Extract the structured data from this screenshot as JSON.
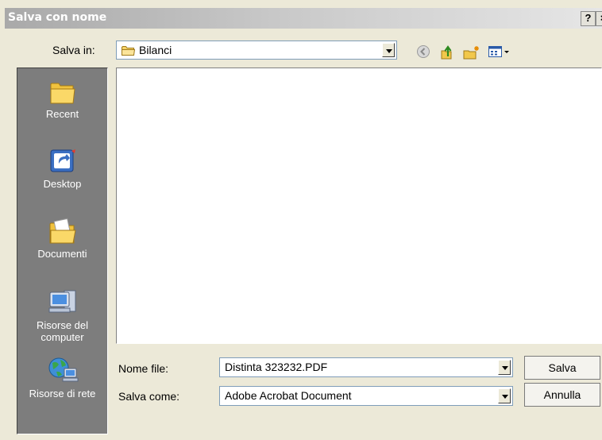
{
  "window": {
    "title": "Salva con nome",
    "help_label": "?",
    "close_label": "×"
  },
  "toolbar": {
    "save_in_label": "Salva in:",
    "current_folder": "Bilanci",
    "tools": [
      "back-icon",
      "up-folder-icon",
      "new-folder-icon",
      "view-menu-icon"
    ]
  },
  "places": [
    {
      "label": "Recent",
      "icon": "recent-folder-icon"
    },
    {
      "label": "Desktop",
      "icon": "desktop-icon"
    },
    {
      "label": "Documenti",
      "icon": "documents-folder-icon"
    },
    {
      "label_line1": "Risorse del",
      "label_line2": "computer",
      "icon": "my-computer-icon"
    },
    {
      "label": "Risorse di rete",
      "icon": "network-icon"
    }
  ],
  "file_list": {
    "items": []
  },
  "footer": {
    "file_name_label": "Nome file:",
    "file_name_value": "Distinta 323232.PDF",
    "save_as_label": "Salva come:",
    "save_as_value": "Adobe Acrobat Document",
    "save_button": "Salva",
    "cancel_button": "Annulla"
  },
  "colors": {
    "dialog_bg": "#ece9d8",
    "places_bg": "#7d7d7d",
    "title_gradient_start": "#a9a9a9"
  }
}
